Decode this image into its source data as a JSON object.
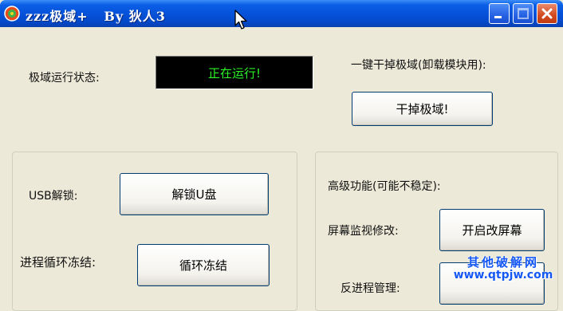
{
  "window": {
    "title": "zzz极域+   By 狄人3",
    "minimize_icon": "minimize-icon",
    "maximize_icon": "maximize-icon",
    "close_icon": "close-icon"
  },
  "status": {
    "label": "极域运行状态:",
    "value": "正在运行!"
  },
  "kill": {
    "label": "一键干掉极域(卸载模块用):",
    "button": "干掉极域!"
  },
  "usb": {
    "label": "USB解锁:",
    "button": "解锁U盘"
  },
  "freeze": {
    "label": "进程循环冻结:",
    "button": "循环冻结"
  },
  "advanced": {
    "label": "高级功能(可能不稳定):",
    "screen_label": "屏幕监视修改:",
    "screen_button": "开启改屏幕",
    "process_label": "反进程管理:"
  },
  "watermark": {
    "line1": "其他破解网",
    "line2": "www.qtpjw.com"
  },
  "colors": {
    "titlebar": "#0551d8",
    "status_text": "#29f329",
    "status_bg": "#000000",
    "window_bg": "#ece9d8"
  }
}
